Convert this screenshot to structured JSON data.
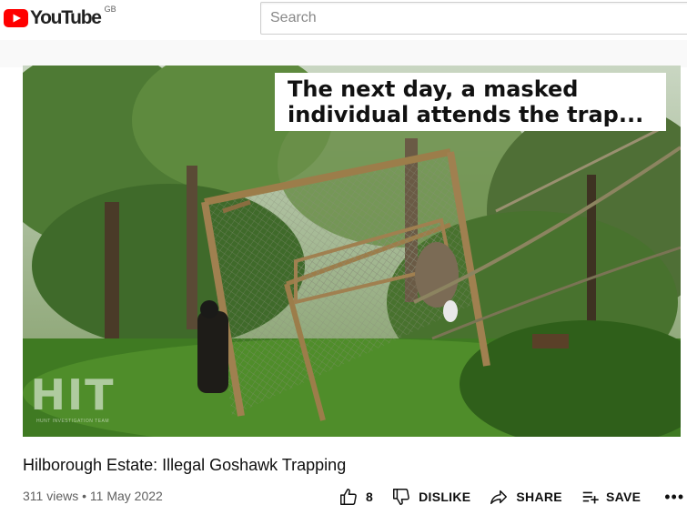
{
  "header": {
    "logo_text": "YouTube",
    "region": "GB",
    "search_placeholder": "Search",
    "brand_color": "#ff0000"
  },
  "video": {
    "overlay_line1": "The next day, a masked",
    "overlay_line2": "individual attends the trap...",
    "watermark": "HIT",
    "watermark_sub": "HUNT INVESTIGATION TEAM"
  },
  "info": {
    "title": "Hilborough Estate: Illegal Goshawk Trapping",
    "views": "311 views",
    "separator": "•",
    "date": "11 May 2022"
  },
  "actions": {
    "like_count": "8",
    "dislike_label": "DISLIKE",
    "share_label": "SHARE",
    "save_label": "SAVE",
    "more_label": "•••"
  },
  "icons": [
    "youtube-logo-icon",
    "thumbs-up-icon",
    "thumbs-down-icon",
    "share-arrow-icon",
    "playlist-add-icon",
    "more-icon"
  ]
}
